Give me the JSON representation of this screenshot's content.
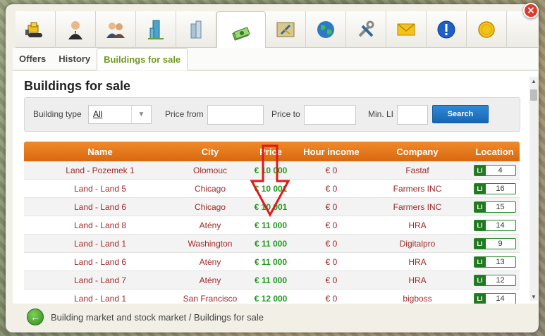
{
  "toolbar": {
    "icons": [
      {
        "name": "bulldozer-icon"
      },
      {
        "name": "businessman-icon"
      },
      {
        "name": "people-icon"
      },
      {
        "name": "skyscraper-icon"
      },
      {
        "name": "buildings-icon"
      },
      {
        "name": "money-stack-icon"
      },
      {
        "name": "map-icon"
      },
      {
        "name": "globe-icon"
      },
      {
        "name": "tools-icon"
      },
      {
        "name": "mail-icon"
      },
      {
        "name": "info-icon"
      },
      {
        "name": "coin-icon"
      }
    ],
    "active_index": 5
  },
  "close_label": "×",
  "subtabs": [
    "Offers",
    "History",
    "Buildings for sale"
  ],
  "page_title": "Buildings for sale",
  "filters": {
    "building_type_label": "Building type",
    "building_type_value": "All",
    "price_from_label": "Price from",
    "price_to_label": "Price to",
    "min_li_label": "Min. LI",
    "search_label": "Search"
  },
  "table": {
    "headers": [
      "Name",
      "City",
      "Price",
      "Hour income",
      "Company",
      "Location"
    ],
    "li_badge": "LI",
    "rows": [
      {
        "name": "Land - Pozemek 1",
        "city": "Olomouc",
        "price": "€ 10 000",
        "income": "€ 0",
        "company": "Fastaf",
        "loc": "4"
      },
      {
        "name": "Land - Land 5",
        "city": "Chicago",
        "price": "€ 10 001",
        "income": "€ 0",
        "company": "Farmers INC",
        "loc": "16"
      },
      {
        "name": "Land - Land 6",
        "city": "Chicago",
        "price": "€ 10 001",
        "income": "€ 0",
        "company": "Farmers INC",
        "loc": "15"
      },
      {
        "name": "Land - Land 8",
        "city": "Atény",
        "price": "€ 11 000",
        "income": "€ 0",
        "company": "HRA",
        "loc": "14"
      },
      {
        "name": "Land - Land 1",
        "city": "Washington",
        "price": "€ 11 000",
        "income": "€ 0",
        "company": "Digitalpro",
        "loc": "9"
      },
      {
        "name": "Land - Land 6",
        "city": "Atény",
        "price": "€ 11 000",
        "income": "€ 0",
        "company": "HRA",
        "loc": "13"
      },
      {
        "name": "Land - Land 7",
        "city": "Atény",
        "price": "€ 11 000",
        "income": "€ 0",
        "company": "HRA",
        "loc": "12"
      },
      {
        "name": "Land - Land 1",
        "city": "San Francisco",
        "price": "€ 12 000",
        "income": "€ 0",
        "company": "bigboss",
        "loc": "14"
      }
    ]
  },
  "footer": {
    "back_icon": "back-arrow-icon",
    "breadcrumb": "Building market and stock market / Buildings for sale"
  },
  "colors": {
    "accent_green": "#6f9a1e",
    "header_orange": "#e27418",
    "price_green": "#1d9a1d",
    "text_red": "#a02a2a",
    "search_blue": "#1f78c8"
  }
}
